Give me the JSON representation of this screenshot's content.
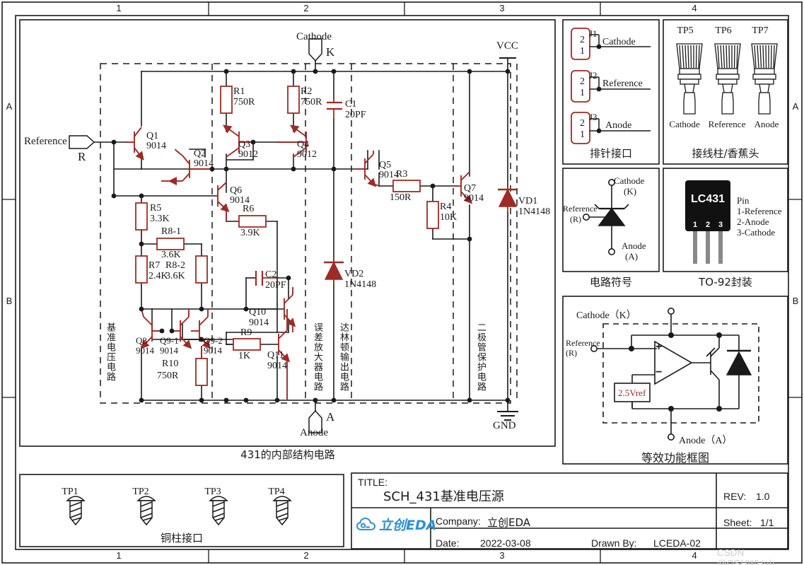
{
  "frame": {
    "columns": [
      "1",
      "2",
      "3",
      "4"
    ],
    "rows": [
      "A",
      "B"
    ],
    "watermark": "CSDN @OSHWHub"
  },
  "main_schematic": {
    "caption": "431的内部结构电路",
    "ports": {
      "reference": "Reference",
      "reference_pin": "R",
      "cathode": "Cathode",
      "cathode_pin": "K",
      "anode": "Anode",
      "anode_pin": "A",
      "vcc": "VCC",
      "gnd": "GND"
    },
    "block_labels": [
      "基准电压电路",
      "误差放大器电路",
      "达林顿输出电路",
      "二极管保护电路"
    ],
    "transistors": [
      {
        "ref": "Q1",
        "part": "9014"
      },
      {
        "ref": "Q2",
        "part": "9014"
      },
      {
        "ref": "Q3",
        "part": "9012"
      },
      {
        "ref": "Q4",
        "part": "9012"
      },
      {
        "ref": "Q5",
        "part": "9014"
      },
      {
        "ref": "Q6",
        "part": "9014"
      },
      {
        "ref": "Q7",
        "part": "9014"
      },
      {
        "ref": "Q8",
        "part": "9014"
      },
      {
        "ref": "Q9-1",
        "part": "9014"
      },
      {
        "ref": "Q9-2",
        "part": "9014"
      },
      {
        "ref": "Q10",
        "part": "9014"
      },
      {
        "ref": "Q11",
        "part": "9014"
      }
    ],
    "resistors": [
      {
        "ref": "R1",
        "value": "750R"
      },
      {
        "ref": "R2",
        "value": "750R"
      },
      {
        "ref": "R3",
        "value": "150R"
      },
      {
        "ref": "R4",
        "value": "10K"
      },
      {
        "ref": "R5",
        "value": "3.3K"
      },
      {
        "ref": "R6",
        "value": "3.9K"
      },
      {
        "ref": "R7",
        "value": "2.4K"
      },
      {
        "ref": "R8-1",
        "value": "3.6K"
      },
      {
        "ref": "R8-2",
        "value": "3.6K"
      },
      {
        "ref": "R9",
        "value": "1K"
      },
      {
        "ref": "R10",
        "value": "750R"
      }
    ],
    "capacitors": [
      {
        "ref": "C1",
        "value": "20PF"
      },
      {
        "ref": "C2",
        "value": "20PF"
      }
    ],
    "diodes": [
      {
        "ref": "VD1",
        "value": "1N4148"
      },
      {
        "ref": "VD2",
        "value": "1N4148"
      }
    ]
  },
  "panel_header": {
    "caption": "排针接口",
    "connectors": [
      {
        "ref": "J1",
        "pin_top": "2",
        "pin_bottom": "1",
        "net": "Cathode"
      },
      {
        "ref": "J2",
        "pin_top": "2",
        "pin_bottom": "1",
        "net": "Reference"
      },
      {
        "ref": "J3",
        "pin_top": "2",
        "pin_bottom": "1",
        "net": "Anode"
      }
    ]
  },
  "panel_banana": {
    "caption": "接线柱/香蕉头",
    "items": [
      {
        "ref": "TP5",
        "net": "Cathode"
      },
      {
        "ref": "TP6",
        "net": "Reference"
      },
      {
        "ref": "TP7",
        "net": "Anode"
      }
    ]
  },
  "panel_symbol": {
    "caption": "电路符号",
    "labels": {
      "cathode": "Cathode",
      "cathode_pin": "(K)",
      "reference": "Reference",
      "reference_pin": "(R)",
      "anode": "Anode",
      "anode_pin": "(A)"
    }
  },
  "panel_package": {
    "caption": "TO-92封装",
    "part": "LC431",
    "pin_numbers": [
      "1",
      "2",
      "3"
    ],
    "pin_header": "Pin",
    "pin_list": [
      "1-Reference",
      "2-Anode",
      "3-Cathode"
    ]
  },
  "panel_block": {
    "caption": "等效功能框图",
    "labels": {
      "cathode": "Cathode（K）",
      "reference": "Reference",
      "reference_pin": "(R)",
      "anode": "Anode（A）",
      "vref": "2.5Vref",
      "plus": "+",
      "minus": "−"
    }
  },
  "panel_copper": {
    "caption": "铜柱接口",
    "items": [
      "TP1",
      "TP2",
      "TP3",
      "TP4"
    ]
  },
  "title_block": {
    "title_label": "TITLE:",
    "title_value": "SCH_431基准电压源",
    "rev_label": "REV:",
    "rev_value": "1.0",
    "company_label": "Company:",
    "company_value": "立创EDA",
    "sheet_label": "Sheet:",
    "sheet_value": "1/1",
    "date_label": "Date:",
    "date_value": "2022-03-08",
    "drawn_label": "Drawn By:",
    "drawn_value": "LCEDA-02",
    "logo_text": "立创EDA"
  },
  "colors": {
    "component": "#9e2b25",
    "wire": "#1a1a1a",
    "brand": "#2f8fd8",
    "frame": "#1a1a1a"
  }
}
